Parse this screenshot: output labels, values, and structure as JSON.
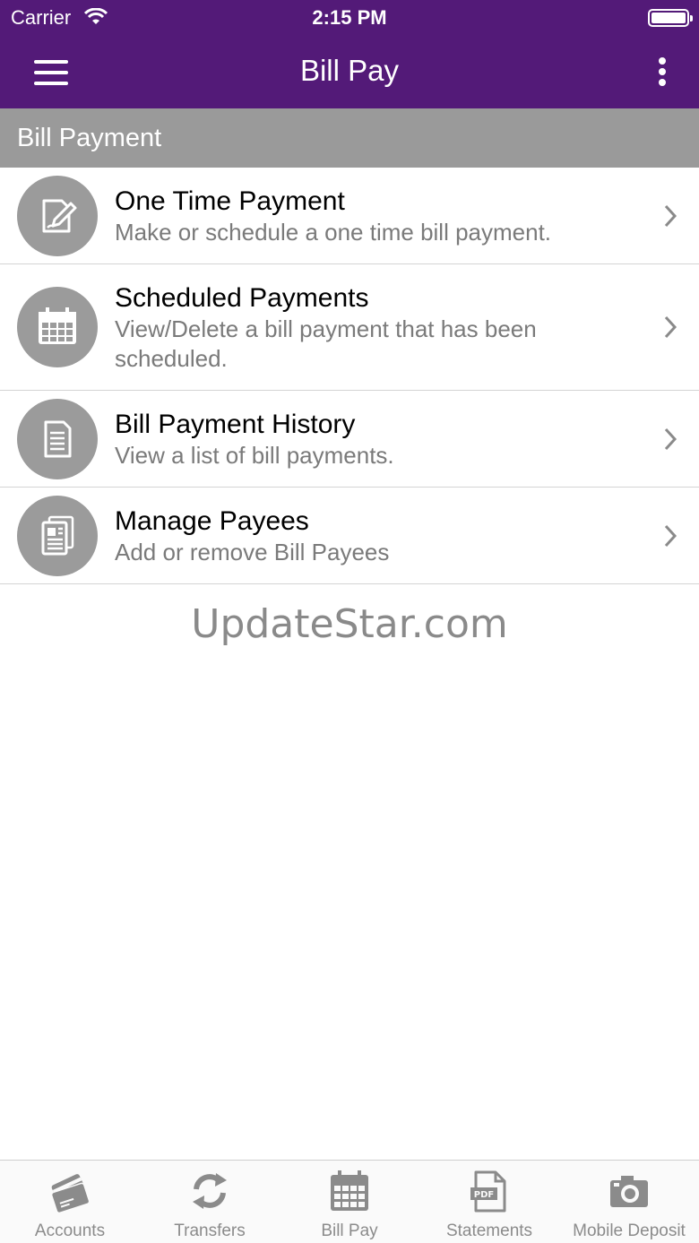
{
  "status_bar": {
    "carrier": "Carrier",
    "time": "2:15 PM"
  },
  "nav": {
    "title": "Bill Pay"
  },
  "section": {
    "title": "Bill Payment"
  },
  "items": [
    {
      "title": "One Time Payment",
      "subtitle": "Make or schedule a one time bill payment.",
      "icon": "edit-document-icon"
    },
    {
      "title": "Scheduled Payments",
      "subtitle": "View/Delete a bill payment that has been scheduled.",
      "icon": "calendar-icon"
    },
    {
      "title": "Bill Payment History",
      "subtitle": "View a list of bill payments.",
      "icon": "document-list-icon"
    },
    {
      "title": "Manage Payees",
      "subtitle": "Add or remove Bill Payees",
      "icon": "payee-document-icon"
    }
  ],
  "watermark": "UpdateStar.com",
  "tabs": [
    {
      "label": "Accounts",
      "icon": "cards-icon"
    },
    {
      "label": "Transfers",
      "icon": "refresh-arrows-icon"
    },
    {
      "label": "Bill Pay",
      "icon": "calendar-icon"
    },
    {
      "label": "Statements",
      "icon": "pdf-icon"
    },
    {
      "label": "Mobile Deposit",
      "icon": "camera-icon"
    }
  ],
  "colors": {
    "brand": "#531a78",
    "section": "#9a9a9a",
    "icon_circle": "#9b9b9b",
    "tab_icon": "#8b8b8b"
  }
}
